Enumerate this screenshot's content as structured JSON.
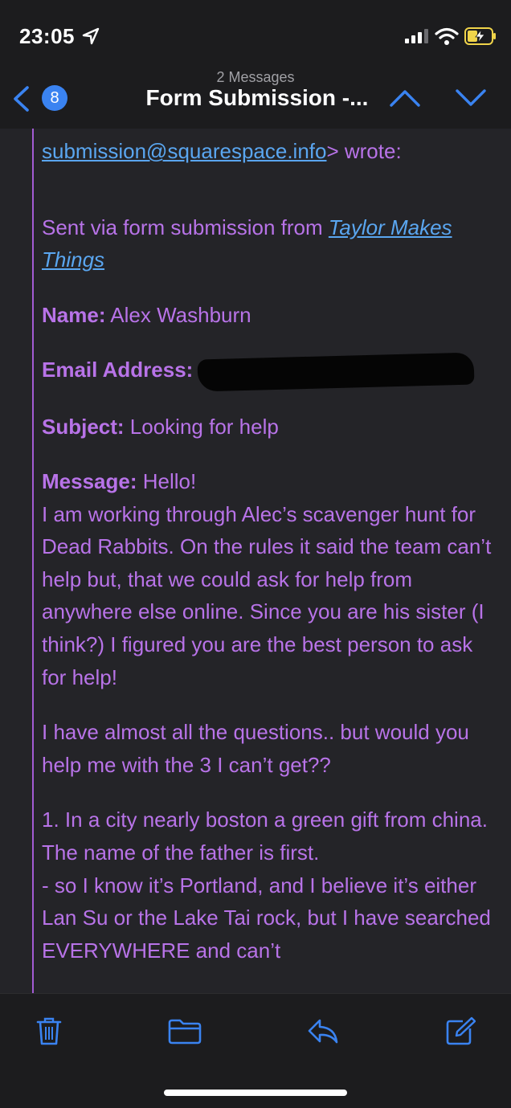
{
  "status_bar": {
    "time": "23:05"
  },
  "nav": {
    "unread_count": "8",
    "subtitle": "2 Messages",
    "title": "Form Submission -..."
  },
  "message": {
    "header_link": "submission@squarespace.info",
    "header_suffix": "> wrote:",
    "sent_via": "Sent via form submission from ",
    "site_link": "Taylor Makes Things",
    "name_label": "Name:",
    "name_value": " Alex Washburn",
    "email_label": "Email Address:",
    "subject_label": "Subject:",
    "subject_value": " Looking for help",
    "message_label": "Message:",
    "message_value": " Hello!",
    "para1": "I am working through Alec’s scavenger hunt for Dead Rabbits. On the rules it said the team can’t help but, that we could ask for help from anywhere else online. Since you are his sister (I think?) I figured you are the best person to ask for help!",
    "para2": "I have almost all the questions.. but would you help me with the 3 I can’t get??",
    "para3_line1": "1. In a city nearly boston a green gift from china. The name of the father is first.",
    "para3_line2": "- so I know it’s Portland, and I believe it’s either Lan Su or the Lake Tai rock, but I have searched EVERYWHERE and can’t"
  },
  "colors": {
    "background": "#1c1c1e",
    "quote_text": "#b873e8",
    "link": "#5aa6f0",
    "accent": "#3a83f1"
  },
  "icons": {
    "status": [
      "location-arrow-icon",
      "signal-icon",
      "wifi-icon",
      "battery-charging-icon"
    ],
    "nav": [
      "back-chevron-icon",
      "chevron-up-icon",
      "chevron-down-icon"
    ],
    "toolbar": [
      "trash-icon",
      "folder-icon",
      "reply-icon",
      "compose-icon"
    ]
  }
}
